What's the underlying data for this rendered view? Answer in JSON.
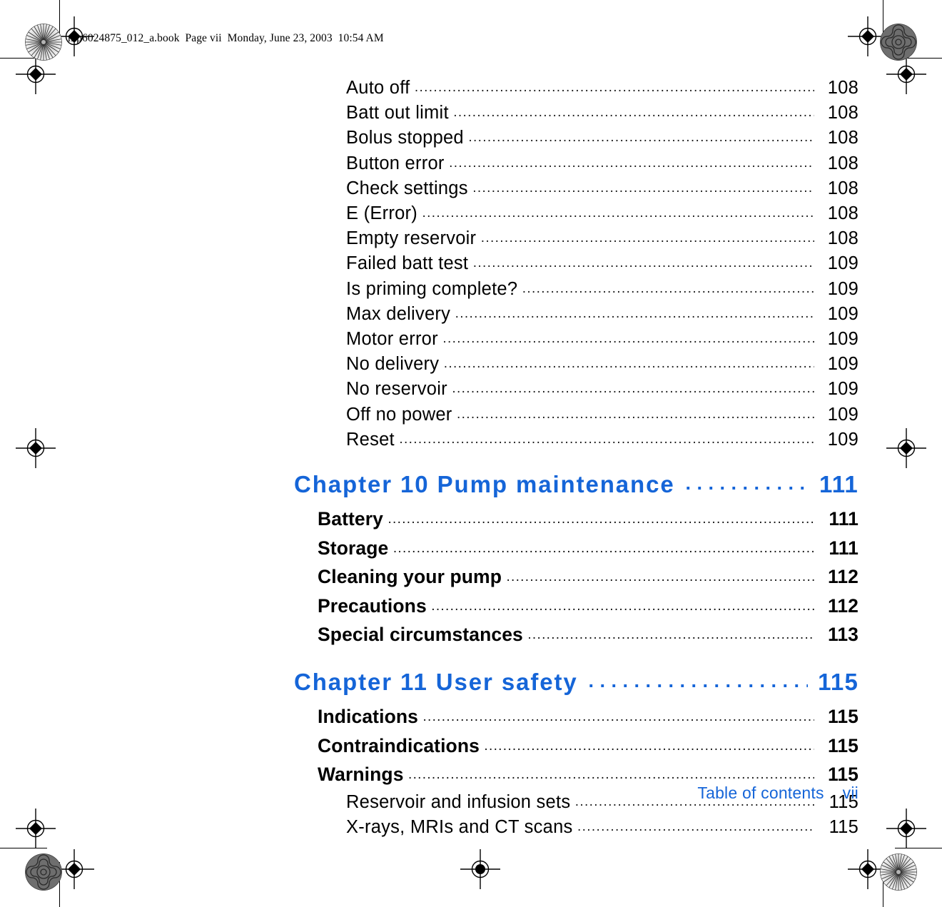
{
  "printing": {
    "file_stamp": "mp6024875_012_a.book  Page vii  Monday, June 23, 2003  10:54 AM",
    "registration_mark_name": "registration-target",
    "moire_mark_name": "moire-density-target"
  },
  "colors": {
    "chapter_blue": "#1565d8",
    "footer_blue": "#1565d8",
    "body_black": "#000000"
  },
  "toc": {
    "alert_entries": [
      {
        "label": "Auto off",
        "page": "108"
      },
      {
        "label": "Batt out limit",
        "page": "108"
      },
      {
        "label": "Bolus stopped",
        "page": "108"
      },
      {
        "label": "Button error",
        "page": "108"
      },
      {
        "label": "Check settings",
        "page": "108"
      },
      {
        "label": "E (Error)",
        "page": "108"
      },
      {
        "label": "Empty reservoir",
        "page": "108"
      },
      {
        "label": "Failed batt test",
        "page": "109"
      },
      {
        "label": "Is priming complete?",
        "page": "109"
      },
      {
        "label": "Max delivery",
        "page": "109"
      },
      {
        "label": "Motor error",
        "page": "109"
      },
      {
        "label": "No delivery",
        "page": "109"
      },
      {
        "label": "No reservoir",
        "page": "109"
      },
      {
        "label": "Off no power",
        "page": "109"
      },
      {
        "label": "Reset",
        "page": "109"
      }
    ],
    "chapter10": {
      "label": "Chapter 10 Pump maintenance",
      "page": "111",
      "sections": [
        {
          "label": "Battery",
          "page": "111"
        },
        {
          "label": "Storage",
          "page": "111"
        },
        {
          "label": "Cleaning your pump",
          "page": "112"
        },
        {
          "label": "Precautions",
          "page": "112"
        },
        {
          "label": "Special circumstances",
          "page": "113"
        }
      ]
    },
    "chapter11": {
      "label": "Chapter 11 User safety",
      "page": "115",
      "sections": [
        {
          "label": "Indications",
          "page": "115"
        },
        {
          "label": "Contraindications",
          "page": "115"
        },
        {
          "label": "Warnings",
          "page": "115"
        }
      ],
      "subsections": [
        {
          "label": "Reservoir and infusion sets",
          "page": "115"
        },
        {
          "label": "X-rays, MRIs and CT scans",
          "page": "115"
        }
      ]
    }
  },
  "footer": {
    "title": "Table of contents",
    "page": "vii"
  }
}
